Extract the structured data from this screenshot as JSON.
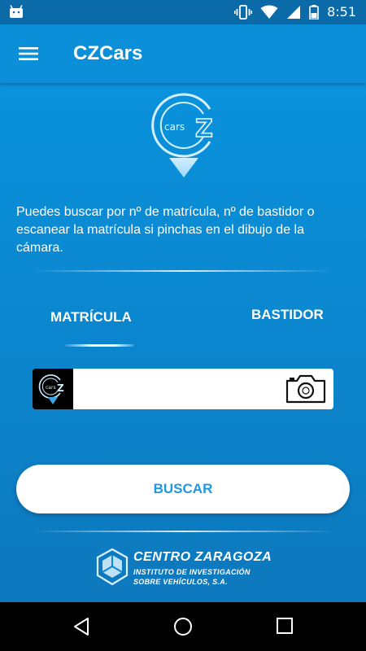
{
  "status_bar": {
    "time": "8:51",
    "icons": [
      "android-icon",
      "vibrate-icon",
      "wifi-icon",
      "signal-icon",
      "battery-icon"
    ]
  },
  "app_bar": {
    "title": "CZCars",
    "menu_icon": "hamburger-menu-icon"
  },
  "logo": {
    "text": "cars",
    "letter": "Z"
  },
  "intro_text": "Puedes buscar por nº de matrícula, nº de bastidor o escanear la matrícula si pinchas en el dibujo de la cámara.",
  "tabs": [
    {
      "label": "MATRÍCULA",
      "selected": true
    },
    {
      "label": "BASTIDOR",
      "selected": false
    }
  ],
  "search": {
    "value": "",
    "placeholder": "",
    "camera_icon": "camera-icon"
  },
  "buscar_button": {
    "label": "BUSCAR"
  },
  "footer": {
    "brand": "CENTRO ZARAGOZA",
    "line1": "INSTITUTO DE INVESTIGACIÓN",
    "line2": "SOBRE VEHÍCULOS, S.A."
  },
  "navigation_bar": {
    "buttons": [
      "back-icon",
      "home-icon",
      "recents-icon"
    ]
  },
  "colors": {
    "status_bar": "#0b6aa8",
    "app_bar": "#0a8fd8",
    "content_background": "#0a92dc",
    "button_text": "#1f97dd"
  }
}
